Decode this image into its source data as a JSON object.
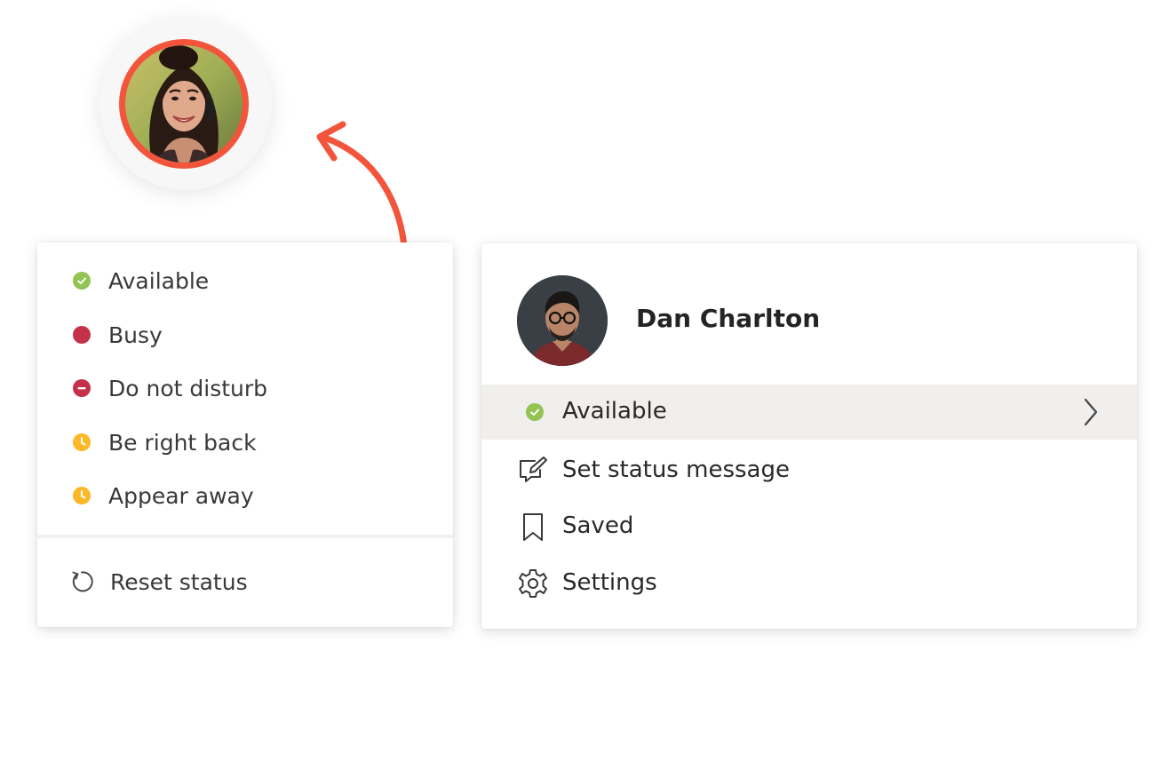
{
  "status_menu": {
    "items": [
      {
        "label": "Available",
        "icon": "available-check-icon",
        "color": "#92c353"
      },
      {
        "label": "Busy",
        "icon": "busy-dot-icon",
        "color": "#c4314b"
      },
      {
        "label": "Do not disturb",
        "icon": "do-not-disturb-icon",
        "color": "#c4314b"
      },
      {
        "label": "Be right back",
        "icon": "clock-icon",
        "color": "#fcb827"
      },
      {
        "label": "Appear away",
        "icon": "clock-icon",
        "color": "#fcb827"
      }
    ],
    "reset_label": "Reset status"
  },
  "profile_card": {
    "name": "Dan Charlton",
    "status_label": "Available",
    "status_color": "#92c353",
    "items": [
      {
        "label": "Set status message",
        "icon": "edit-message-icon"
      },
      {
        "label": "Saved",
        "icon": "bookmark-icon"
      },
      {
        "label": "Settings",
        "icon": "gear-icon"
      }
    ]
  },
  "colors": {
    "accent_ring": "#f2553b",
    "hover_bg": "#f0efee"
  }
}
